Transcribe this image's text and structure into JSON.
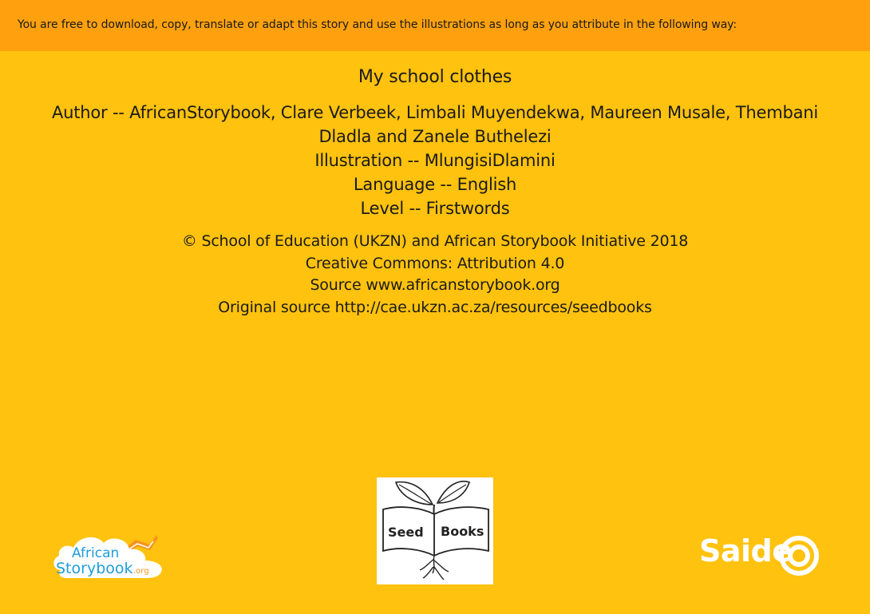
{
  "notice": {
    "text": "You are free to download, copy, translate or adapt this story and use the illustrations as long as you attribute in the following way:"
  },
  "story": {
    "title": "My school clothes",
    "author": "Author -- AfricanStorybook, Clare Verbeek, Limbali Muyendekwa, Maureen Musale, Thembani Dladla and Zanele Buthelezi",
    "illustration": "Illustration -- MlungisiDlamini",
    "language": "Language -- English",
    "level": "Level -- Firstwords"
  },
  "rights": {
    "copyright": "© School of Education (UKZN) and African Storybook Initiative 2018",
    "license": "Creative Commons: Attribution 4.0",
    "source": "Source www.africanstorybook.org",
    "original_source": "Original source http://cae.ukzn.ac.za/resources/seedbooks"
  },
  "logos": {
    "african_storybook": {
      "line1": "African",
      "line2": "Storybook",
      "suffix": ".org"
    },
    "seed_books": {
      "word1": "Seed",
      "word2": "Books"
    },
    "saide": {
      "text": "Saide"
    }
  },
  "colors": {
    "background": "#FFC20E",
    "notice_bar": "#FFA10F",
    "asb_blue": "#1F9ED8",
    "asb_orange": "#F7941D"
  }
}
